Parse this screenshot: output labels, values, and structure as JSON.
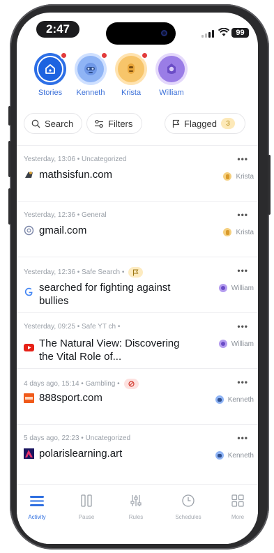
{
  "status": {
    "time": "2:47",
    "battery": "99"
  },
  "profiles": [
    {
      "name": "Stories",
      "ring": "#2d6fe6",
      "fill": "#1d63e0",
      "has_alert": true,
      "icon": "home-icon"
    },
    {
      "name": "Kenneth",
      "ring": "#cfe0ff",
      "fill": "#8fb4f5",
      "has_alert": true,
      "icon": "robot-avatar-icon"
    },
    {
      "name": "Krista",
      "ring": "#ffe3b0",
      "fill": "#f7c56a",
      "has_alert": true,
      "icon": "robot-avatar-icon"
    },
    {
      "name": "William",
      "ring": "#e4d8fb",
      "fill": "#9a7de6",
      "has_alert": false,
      "icon": "robot-avatar-icon"
    }
  ],
  "filters": {
    "search_label": "Search",
    "filters_label": "Filters",
    "flagged_label": "Flagged",
    "flagged_count": "3"
  },
  "activity": [
    {
      "meta": "Yesterday, 13:06 • Uncategorized",
      "title": "mathsisfun.com",
      "user": "Krista",
      "user_color": "#f0b94a",
      "icon": "math-site-icon",
      "tag": ""
    },
    {
      "meta": "Yesterday, 12:36 • General",
      "title": "gmail.com",
      "user": "Krista",
      "user_color": "#f0b94a",
      "icon": "gmail-globe-icon",
      "tag": ""
    },
    {
      "meta": "Yesterday, 12:36 • Safe Search •",
      "title": "searched for fighting against bullies",
      "user": "William",
      "user_color": "#8b6ee0",
      "icon": "google-icon",
      "tag": "flag"
    },
    {
      "meta": "Yesterday, 09:25 • Safe YT  ch •",
      "title": "The Natural View: Discovering the Vital Role of...",
      "user": "William",
      "user_color": "#8b6ee0",
      "icon": "youtube-icon",
      "tag": ""
    },
    {
      "meta": "4 days ago, 15:14 • Gambling •",
      "title": "888sport.com",
      "user": "Kenneth",
      "user_color": "#4f86e8",
      "icon": "sport-site-icon",
      "tag": "blocked"
    },
    {
      "meta": "5 days ago, 22:23 • Uncategorized",
      "title": "polarislearning.art",
      "user": "Kenneth",
      "user_color": "#4f86e8",
      "icon": "polaris-site-icon",
      "tag": ""
    }
  ],
  "tabs": [
    {
      "label": "Activity",
      "icon": "activity-icon",
      "active": true
    },
    {
      "label": "Pause",
      "icon": "pause-icon",
      "active": false
    },
    {
      "label": "Rules",
      "icon": "sliders-icon",
      "active": false
    },
    {
      "label": "Schedules",
      "icon": "clock-icon",
      "active": false
    },
    {
      "label": "More",
      "icon": "grid-icon",
      "active": false
    }
  ]
}
